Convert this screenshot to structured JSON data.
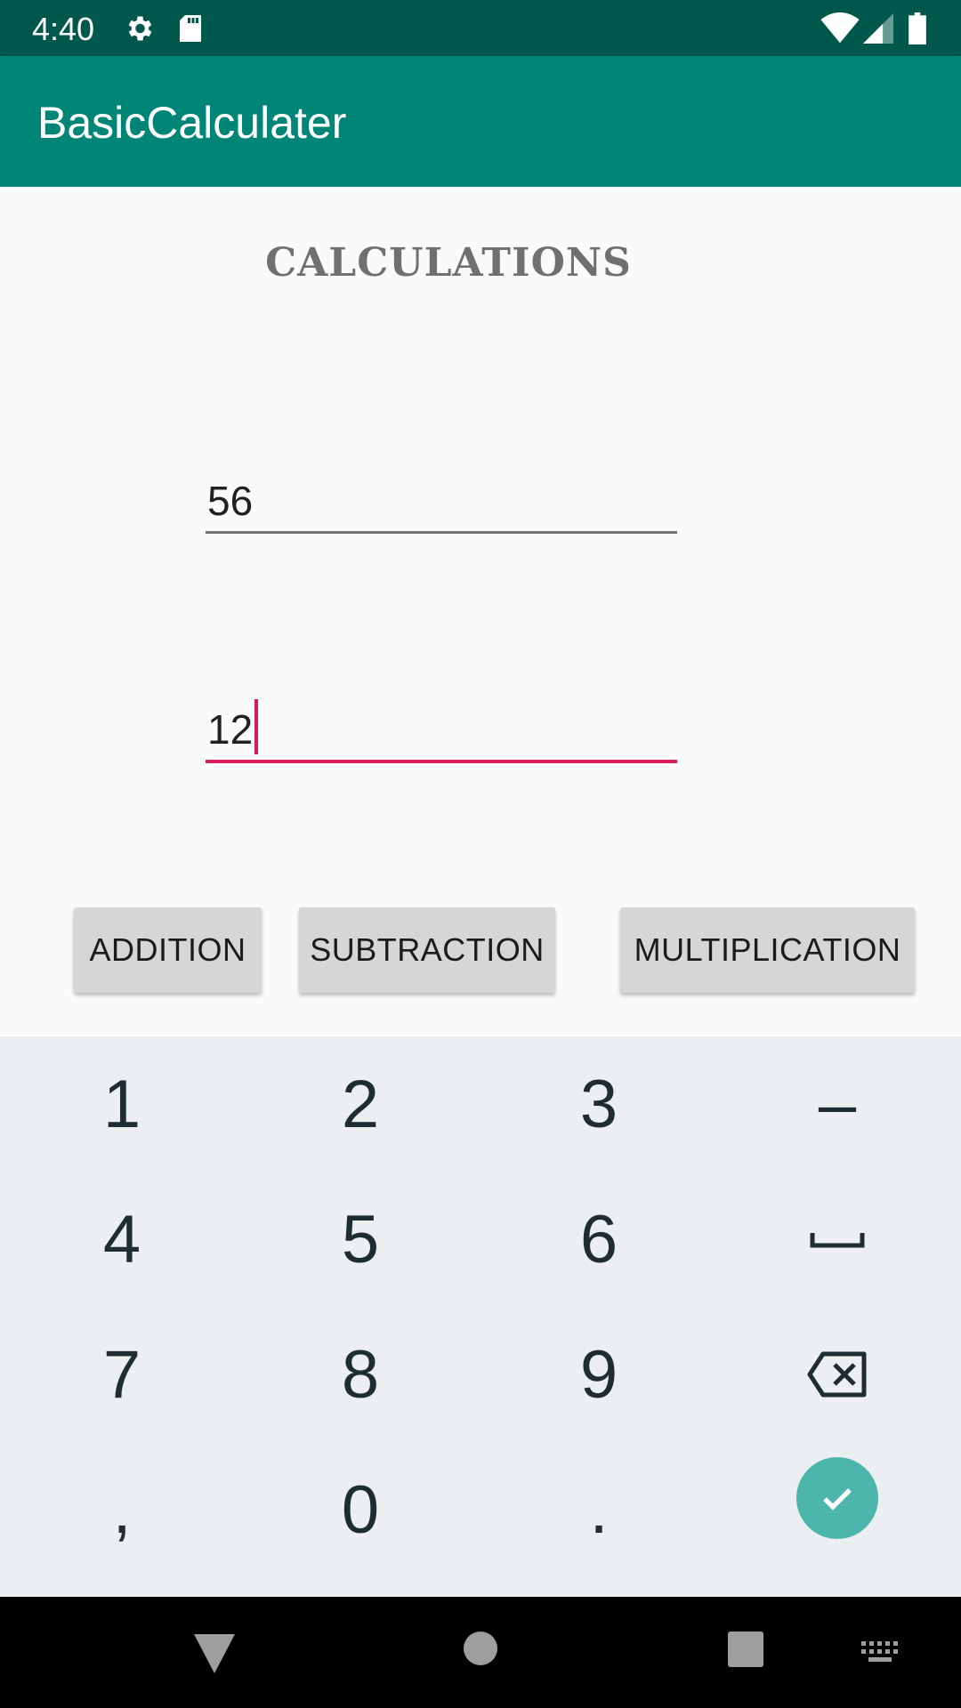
{
  "status_bar": {
    "time": "4:40",
    "icons": [
      "gear-icon",
      "sd-card-icon",
      "wifi-icon",
      "signal-icon",
      "battery-icon"
    ]
  },
  "app_bar": {
    "title": "BasicCalculater"
  },
  "main": {
    "heading": "CALCULATIONS",
    "first_number": "56",
    "second_number": "12",
    "buttons": {
      "addition": "ADDITION",
      "subtraction": "SUBTRACTION",
      "multiplication": "MULTIPLICATION"
    }
  },
  "keyboard": {
    "keys": [
      "1",
      "2",
      "3",
      "–",
      "4",
      "5",
      "6",
      "␣",
      "7",
      "8",
      "9",
      "⌫",
      ",",
      "0",
      ".",
      "✓"
    ],
    "row1": [
      "1",
      "2",
      "3",
      "–"
    ],
    "row2": [
      "4",
      "5",
      "6"
    ],
    "row3": [
      "7",
      "8",
      "9"
    ],
    "row4": [
      ",",
      "0",
      "."
    ]
  },
  "nav_bar": {
    "icons": [
      "back-icon",
      "home-icon",
      "recents-icon",
      "keyboard-switch-icon"
    ]
  },
  "colors": {
    "primary": "#008577",
    "primary_dark": "#00574b",
    "accent": "#d81b60",
    "done_key": "#4db6ac"
  }
}
